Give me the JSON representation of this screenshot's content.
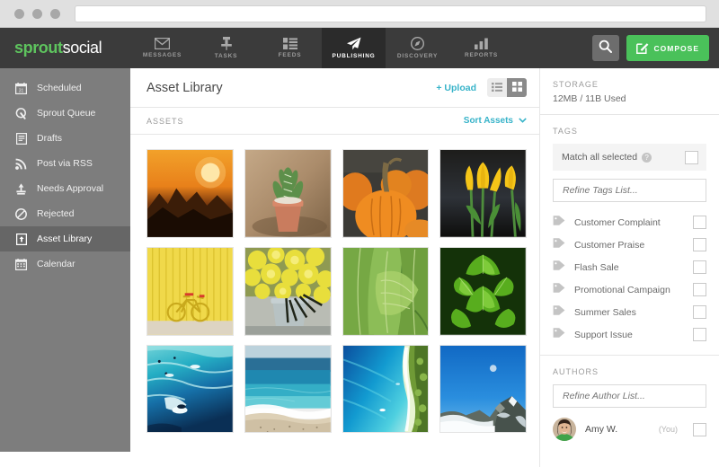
{
  "browser": {
    "url_value": "",
    "url_placeholder": ""
  },
  "topnav": {
    "logo_primary": "sprout",
    "logo_secondary": "social",
    "items": [
      {
        "label": "MESSAGES",
        "icon": "envelope-icon",
        "active": false
      },
      {
        "label": "TASKS",
        "icon": "pin-icon",
        "active": false
      },
      {
        "label": "FEEDS",
        "icon": "feeds-icon",
        "active": false
      },
      {
        "label": "PUBLISHING",
        "icon": "paper-plane-icon",
        "active": true
      },
      {
        "label": "DISCOVERY",
        "icon": "compass-icon",
        "active": false
      },
      {
        "label": "REPORTS",
        "icon": "bar-chart-icon",
        "active": false
      }
    ],
    "search_icon": "search-icon",
    "compose_label": "COMPOSE",
    "compose_icon": "compose-pencil-icon",
    "compose_color": "#4ac15a"
  },
  "sidebar": {
    "items": [
      {
        "label": "Scheduled",
        "icon": "calendar-day-icon",
        "active": false
      },
      {
        "label": "Sprout Queue",
        "icon": "sprout-queue-icon",
        "active": false
      },
      {
        "label": "Drafts",
        "icon": "document-icon",
        "active": false
      },
      {
        "label": "Post via RSS",
        "icon": "rss-icon",
        "active": false
      },
      {
        "label": "Needs Approval",
        "icon": "stamp-icon",
        "active": false
      },
      {
        "label": "Rejected",
        "icon": "block-icon",
        "active": false
      },
      {
        "label": "Asset Library",
        "icon": "upload-box-icon",
        "active": true
      },
      {
        "label": "Calendar",
        "icon": "calendar-grid-icon",
        "active": false
      }
    ]
  },
  "main": {
    "title": "Asset Library",
    "upload_label": "+ Upload",
    "view_list_icon": "list-view-icon",
    "view_grid_icon": "grid-view-icon",
    "active_view": "grid",
    "assets_label": "ASSETS",
    "sort_label": "Sort Assets",
    "sort_icon": "chevron-down-icon",
    "assets": [
      {
        "name": "sunset-mountains"
      },
      {
        "name": "potted-cactus"
      },
      {
        "name": "pumpkins"
      },
      {
        "name": "yellow-tulips"
      },
      {
        "name": "bicycle-yellow-wall"
      },
      {
        "name": "yellow-flowers-vase"
      },
      {
        "name": "green-lettuce-leaves"
      },
      {
        "name": "green-leaves"
      },
      {
        "name": "surfers-ocean"
      },
      {
        "name": "beach-shoreline"
      },
      {
        "name": "aerial-coastline"
      },
      {
        "name": "snowy-mountain-peak"
      }
    ]
  },
  "right_panel": {
    "storage_label": "STORAGE",
    "storage_value": "12MB / 11B Used",
    "tags_label": "TAGS",
    "match_all_label": "Match all selected",
    "match_all_help_icon": "help-icon",
    "match_all_checked": false,
    "tags_filter_placeholder": "Refine Tags List...",
    "tags_filter_value": "",
    "tags": [
      {
        "label": "Customer Complaint",
        "checked": false
      },
      {
        "label": "Customer Praise",
        "checked": false
      },
      {
        "label": "Flash Sale",
        "checked": false
      },
      {
        "label": "Promotional Campaign",
        "checked": false
      },
      {
        "label": "Summer Sales",
        "checked": false
      },
      {
        "label": "Support Issue",
        "checked": false
      }
    ],
    "authors_label": "AUTHORS",
    "authors_filter_placeholder": "Refine Author List...",
    "authors_filter_value": "",
    "authors": [
      {
        "name": "Amy W.",
        "you_label": "(You)",
        "checked": false
      }
    ]
  },
  "colors": {
    "nav_bg": "#3b3b3b",
    "nav_active_bg": "#2b2b2b",
    "sidebar_bg": "#7d7d7d",
    "sidebar_active_bg": "#666666",
    "accent_teal": "#37b3c9",
    "accent_green": "#4ac15a"
  }
}
